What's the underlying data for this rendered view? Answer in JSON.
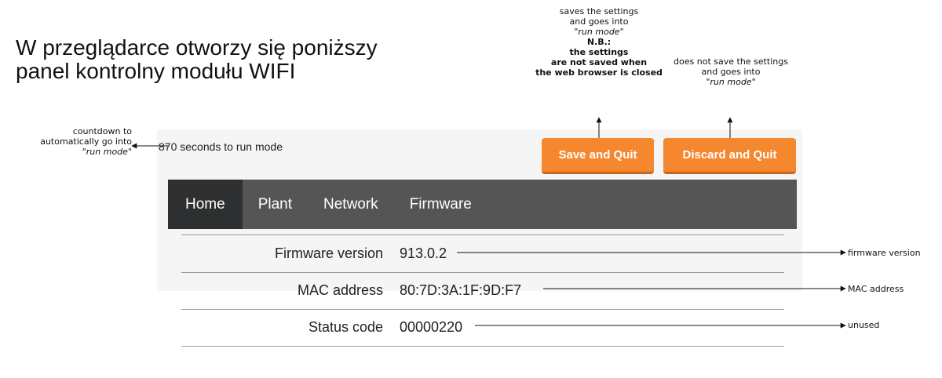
{
  "heading": {
    "line1": "W przeglądarce otworzy się poniższy",
    "line2": "panel kontrolny modułu WIFI"
  },
  "annotations": {
    "save": {
      "l1": "saves the settings",
      "l2": "and goes into",
      "l3_q1": "\"",
      "l3_em": "run mode",
      "l3_q2": "\"",
      "l4": "N.B.:",
      "l5": "the settings",
      "l6": "are not saved when",
      "l7": "the web browser is closed"
    },
    "discard": {
      "l1": "does not save the settings",
      "l2": "and goes into",
      "l3_q1": "\"",
      "l3_em": "run mode",
      "l3_q2": "\""
    },
    "countdown": {
      "l1": "countdown to",
      "l2": "automatically go into",
      "l3_q1": "\"",
      "l3_em": "run mode",
      "l3_q2": "\""
    },
    "firmware": "firmware version",
    "mac": "MAC address",
    "status": "unused"
  },
  "panel": {
    "countdown": "870 seconds to run mode",
    "save_button": "Save and Quit",
    "discard_button": "Discard and Quit",
    "nav": [
      "Home",
      "Plant",
      "Network",
      "Firmware"
    ],
    "rows": [
      {
        "label": "Firmware version",
        "value": "913.0.2"
      },
      {
        "label": "MAC address",
        "value": "80:7D:3A:1F:9D:F7"
      },
      {
        "label": "Status code",
        "value": "00000220"
      }
    ]
  },
  "colors": {
    "button": "#f5872f",
    "navbar": "#555555",
    "nav_active": "#2d2f30",
    "panel_bg": "#f5f5f5"
  }
}
